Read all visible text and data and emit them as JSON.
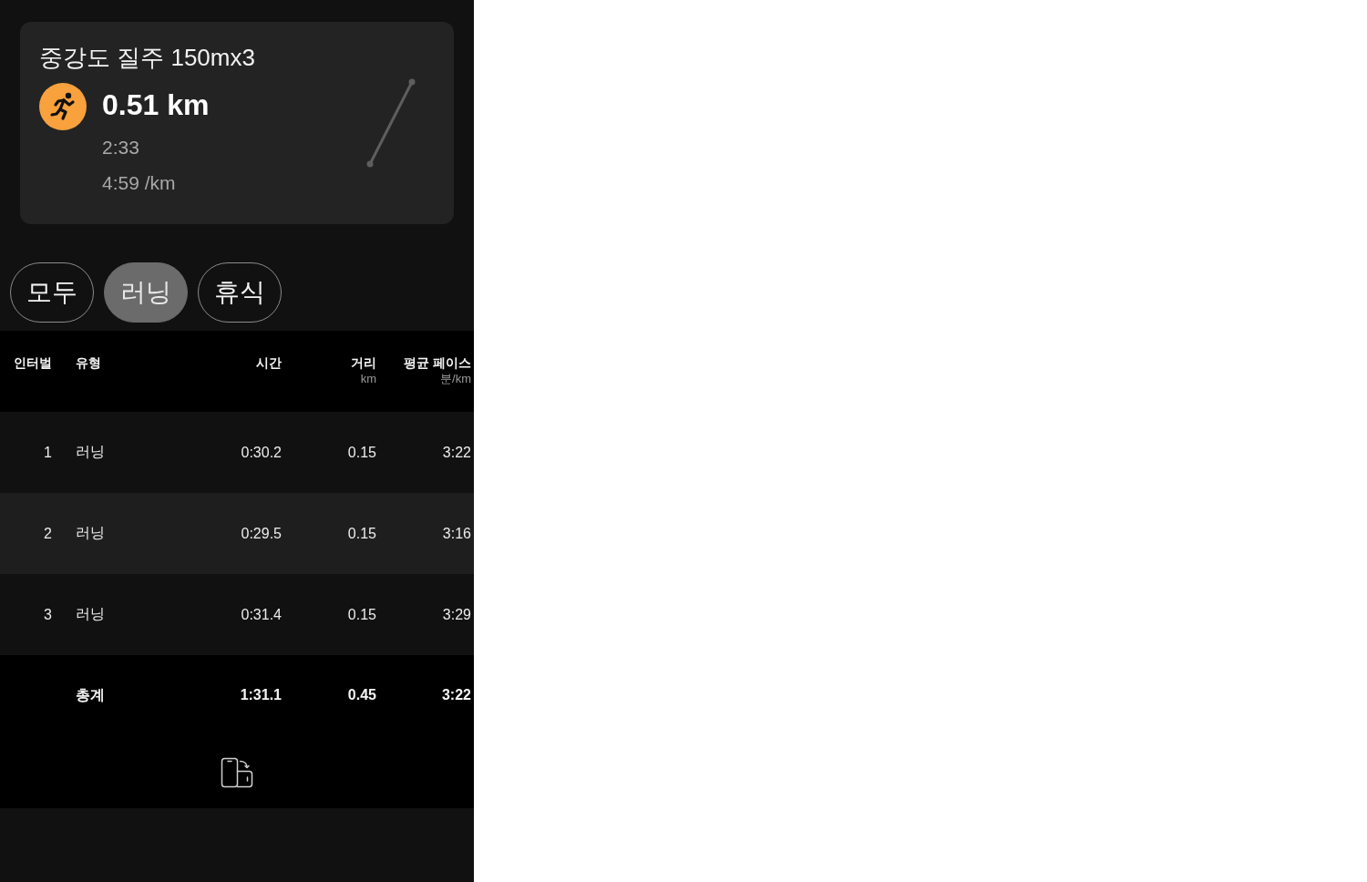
{
  "workout": {
    "title": "중강도 질주 150mx3",
    "distance": "0.51 km",
    "duration": "2:33",
    "pace": "4:59 /km"
  },
  "filters": [
    {
      "label": "모두",
      "selected": false
    },
    {
      "label": "러닝",
      "selected": true
    },
    {
      "label": "휴식",
      "selected": false
    }
  ],
  "table": {
    "columns": [
      {
        "label": "인터벌"
      },
      {
        "label": "유형"
      },
      {
        "label": "시간"
      },
      {
        "label": "거리",
        "unit": "km"
      },
      {
        "label": "평균 페이스",
        "unit": "분/km"
      }
    ],
    "rows": [
      {
        "interval": "1",
        "type": "러닝",
        "time": "0:30.2",
        "distance": "0.15",
        "pace": "3:22"
      },
      {
        "interval": "2",
        "type": "러닝",
        "time": "0:29.5",
        "distance": "0.15",
        "pace": "3:16"
      },
      {
        "interval": "3",
        "type": "러닝",
        "time": "0:31.4",
        "distance": "0.15",
        "pace": "3:29"
      }
    ],
    "total": {
      "label": "총계",
      "time": "1:31.1",
      "distance": "0.45",
      "pace": "3:22"
    }
  }
}
